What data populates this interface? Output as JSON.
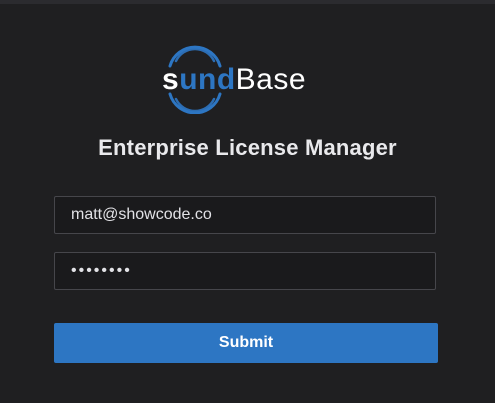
{
  "brand": {
    "logo_text_white_1": "s",
    "logo_text_blue": "und",
    "logo_text_white_2": "Base",
    "logo_full": "soundBase",
    "accent_color": "#2d76c3"
  },
  "page": {
    "title": "Enterprise License Manager"
  },
  "form": {
    "email_value": "matt@showcode.co",
    "password_value": "••••••••",
    "submit_label": "Submit"
  },
  "colors": {
    "background": "#1f1f21",
    "field_border": "#46464b",
    "button": "#2d76c3",
    "text": "#e9e9ec"
  }
}
